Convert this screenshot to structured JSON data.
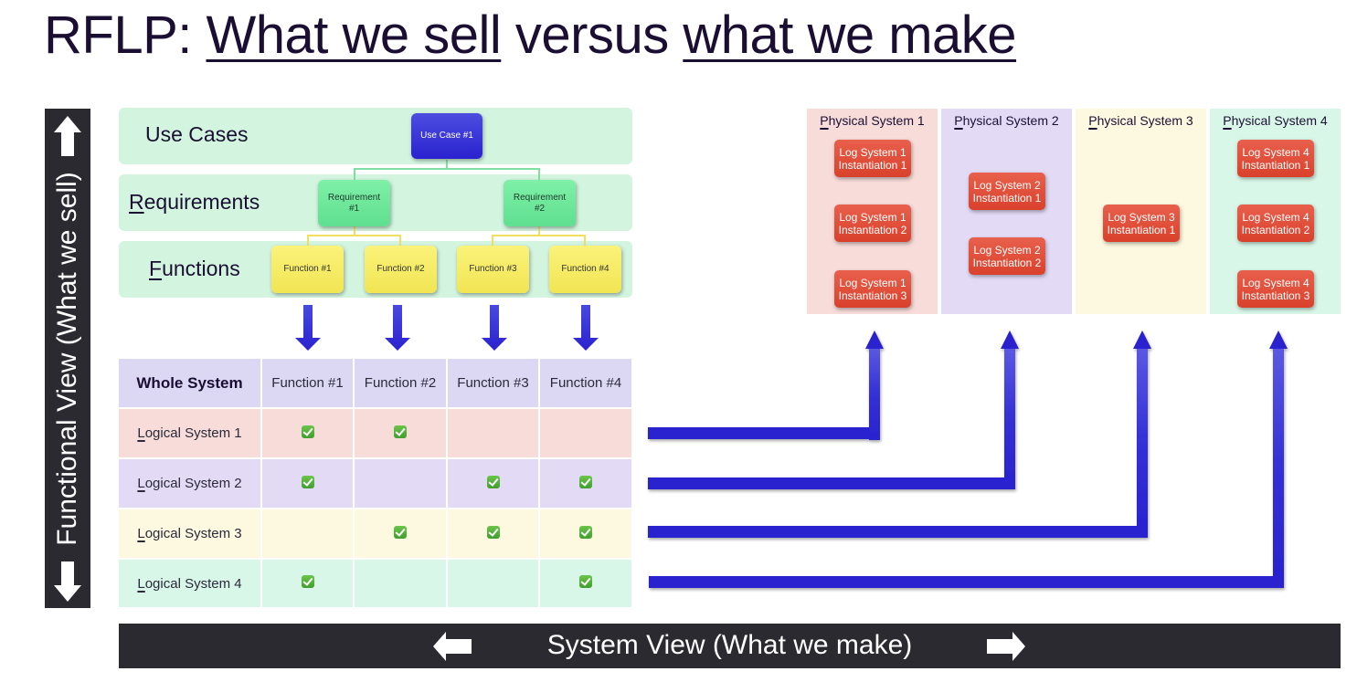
{
  "title": {
    "prefix": "RFLP: ",
    "part1": "What we sell",
    "middle": " versus ",
    "part2": "what we make"
  },
  "side_labels": {
    "vertical": "Functional View (What we sell)",
    "horizontal": "System View (What we make)"
  },
  "icons": {
    "vertical_top": "arrow-up-icon",
    "vertical_bottom": "arrow-down-icon",
    "horizontal_left": "arrow-left-icon",
    "horizontal_right": "arrow-right-icon",
    "check": "checkmark-icon"
  },
  "hierarchy": {
    "bands": [
      {
        "label_first": "",
        "label_rest": "Use Cases"
      },
      {
        "label_first": "R",
        "label_rest": "equirements"
      },
      {
        "label_first": "F",
        "label_rest": "unctions"
      }
    ],
    "use_case": "Use Case #1",
    "requirements": [
      "Requirement #1",
      "Requirement #2"
    ],
    "functions": [
      "Function #1",
      "Function #2",
      "Function #3",
      "Function #4"
    ]
  },
  "matrix": {
    "corner": "Whole System",
    "columns": [
      "Function #1",
      "Function #2",
      "Function #3",
      "Function #4"
    ],
    "rows": [
      {
        "label_first": "L",
        "label_rest": "ogical System 1",
        "checks": [
          true,
          true,
          false,
          false
        ],
        "color": "#f7dcd9"
      },
      {
        "label_first": "L",
        "label_rest": "ogical System 2",
        "checks": [
          true,
          false,
          true,
          true
        ],
        "color": "#e3dbf6"
      },
      {
        "label_first": "L",
        "label_rest": "ogical System 3",
        "checks": [
          false,
          true,
          true,
          true
        ],
        "color": "#fdf9e0"
      },
      {
        "label_first": "L",
        "label_rest": "ogical System 4",
        "checks": [
          true,
          false,
          false,
          true
        ],
        "color": "#d9f7e8"
      }
    ],
    "header_color": "#dcd8f4"
  },
  "physical": [
    {
      "title_first": "P",
      "title_rest": "hysical System 1",
      "color": "#f7dcd9",
      "instances": [
        [
          "Log System 1",
          "Instantiation 1"
        ],
        [
          "Log System 1",
          "Instantiation 2"
        ],
        [
          "Log System 1",
          "Instantiation 3"
        ]
      ]
    },
    {
      "title_first": "P",
      "title_rest": "hysical System 2",
      "color": "#e3dbf6",
      "instances": [
        [
          "Log System 2",
          "Instantiation 1"
        ],
        [
          "Log System 2",
          "Instantiation 2"
        ]
      ]
    },
    {
      "title_first": "P",
      "title_rest": "hysical System 3",
      "color": "#fdf9e0",
      "instances": [
        [
          "Log System 3",
          "Instantiation 1"
        ]
      ]
    },
    {
      "title_first": "P",
      "title_rest": "hysical System 4",
      "color": "#d9f7e8",
      "instances": [
        [
          "Log System 4",
          "Instantiation 1"
        ],
        [
          "Log System 4",
          "Instantiation 2"
        ],
        [
          "Log System 4",
          "Instantiation 3"
        ]
      ]
    }
  ],
  "colors": {
    "text_dark": "#1a0f33",
    "bar_dark": "#2b2a30",
    "arrow_blue": "#2a22cf",
    "band_green": "#d3f5e0",
    "node_red": "#e0503a"
  }
}
